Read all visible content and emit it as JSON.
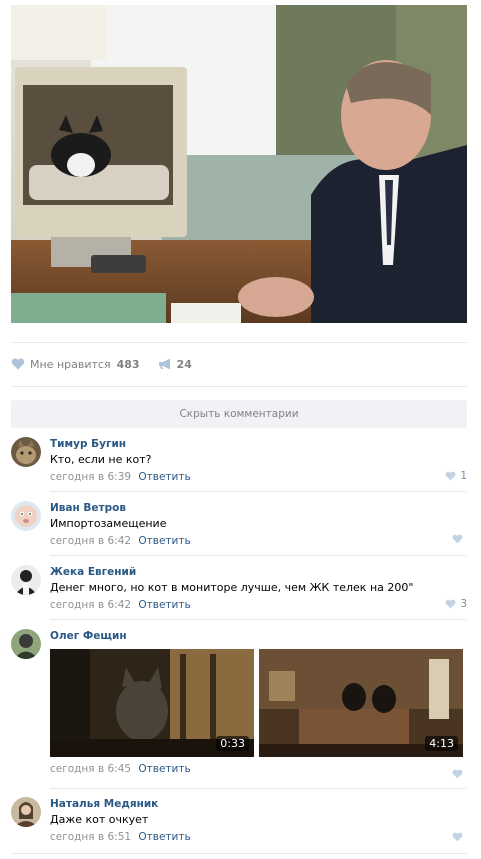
{
  "post": {
    "image_alt": "Photo: cat sitting inside an empty computer monitor, man in suit looking at it",
    "likes": {
      "label": "Мне нравится",
      "count": "483"
    },
    "shares": {
      "count": "24"
    }
  },
  "comments_toggle": "Скрыть комментарии",
  "reply_label": "Ответить",
  "colors": {
    "link": "#2a5885",
    "muted": "#939393",
    "divider": "#e7e8ec"
  },
  "comments": [
    {
      "author": "Тимур Бугин",
      "text": "Кто, если не кот?",
      "time": "сегодня в 6:39",
      "likes": "1"
    },
    {
      "author": "Иван Ветров",
      "text": "Импортозамещение",
      "time": "сегодня в 6:42",
      "likes": ""
    },
    {
      "author": "Жека Евгений",
      "text": "Денег много, но кот в мониторе лучше, чем ЖК телек на 200\"",
      "time": "сегодня в 6:42",
      "likes": "3"
    },
    {
      "author": "Олег Фещин",
      "time": "сегодня в 6:45",
      "likes": "",
      "videos": [
        {
          "duration": "0:33"
        },
        {
          "duration": "4:13"
        }
      ]
    },
    {
      "author": "Наталья Медяник",
      "text": "Даже кот очкует",
      "time": "сегодня в 6:51",
      "likes": ""
    }
  ]
}
